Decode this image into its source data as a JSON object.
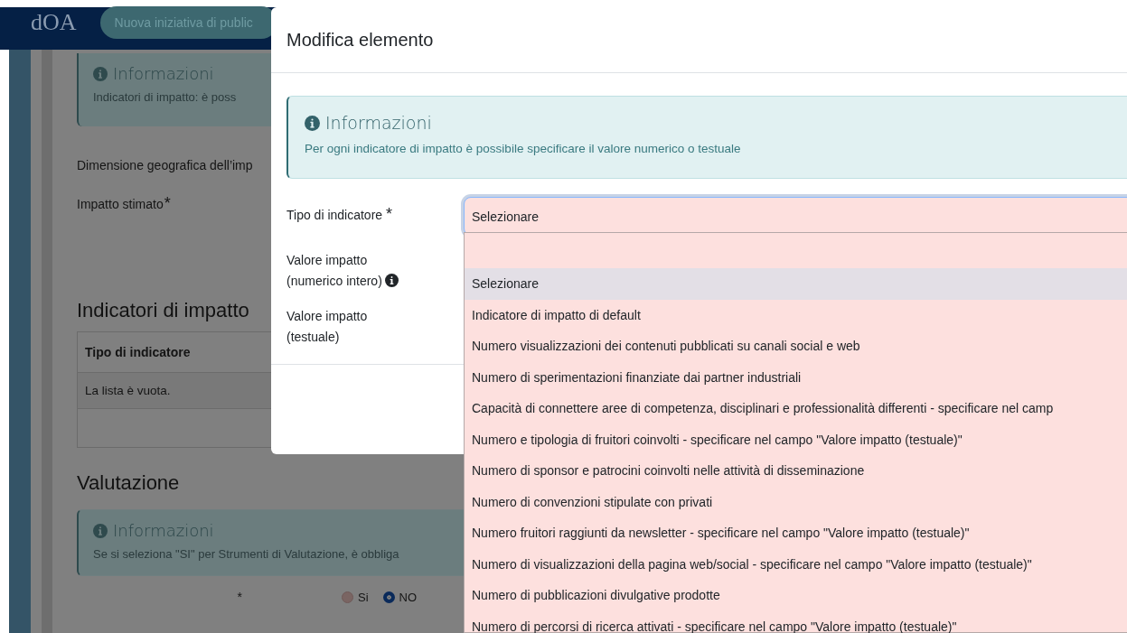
{
  "app": {
    "logo": "dOA",
    "context_pill": "Nuova iniziativa di public"
  },
  "page": {
    "info_box": {
      "title": "Informazioni",
      "text": "Indicatori di impatto: è poss"
    },
    "geo_label": "Dimensione geografica dell’imp",
    "impact_label": "Impatto stimato",
    "impact_required_mark": "*",
    "indicators_section": {
      "title": "Indicatori di impatto",
      "table": {
        "columns": [
          "Tipo di indicatore"
        ],
        "empty_message": "La lista è vuota."
      }
    },
    "evaluation_section": {
      "title": "Valutazione",
      "info_box": {
        "title": "Informazioni",
        "text": "Se si seleziona \"SI\" per Strumenti di Valutazione, è obbliga"
      },
      "required_mark": "*",
      "radio_options": [
        {
          "label": "Si",
          "selected": false
        },
        {
          "label": "NO",
          "selected": true
        }
      ]
    }
  },
  "modal": {
    "title": "Modifica elemento",
    "info_box": {
      "title": "Informazioni",
      "text": "Per ogni indicatore di impatto è possibile specificare il valore numerico o testuale"
    },
    "fields": [
      {
        "label": "Tipo di indicatore",
        "required_mark": "*",
        "info": false
      },
      {
        "label": "Valore impatto (numerico intero)",
        "info": true
      },
      {
        "label": "Valore impatto (testuale)",
        "info": false
      }
    ],
    "select": {
      "value": "Selezionare",
      "expanded": true,
      "options": [
        {
          "label": "Selezionare",
          "selected": true
        },
        {
          "label": "Indicatore di impatto di default",
          "selected": false
        },
        {
          "label": "Numero visualizzazioni dei contenuti pubblicati su canali social e web",
          "selected": false
        },
        {
          "label": "Numero di sperimentazioni finanziate dai partner industriali",
          "selected": false
        },
        {
          "label": "Capacità di connettere aree di competenza, disciplinari e professionalità differenti - specificare nel camp",
          "selected": false
        },
        {
          "label": "Numero e tipologia di fruitori coinvolti - specificare nel campo \"Valore impatto (testuale)\"",
          "selected": false
        },
        {
          "label": "Numero di sponsor e patrocini coinvolti nelle attività di disseminazione",
          "selected": false
        },
        {
          "label": "Numero di convenzioni stipulate con privati",
          "selected": false
        },
        {
          "label": "Numero fruitori raggiunti da newsletter - specificare nel campo \"Valore impatto (testuale)\"",
          "selected": false
        },
        {
          "label": "Numero di visualizzazioni della pagina web/social - specificare nel campo \"Valore impatto (testuale)\"",
          "selected": false
        },
        {
          "label": "Numero di pubblicazioni divulgative prodotte",
          "selected": false
        },
        {
          "label": "Numero di percorsi di ricerca attivati - specificare nel campo \"Valore impatto (testuale)\"",
          "selected": false
        }
      ]
    }
  }
}
